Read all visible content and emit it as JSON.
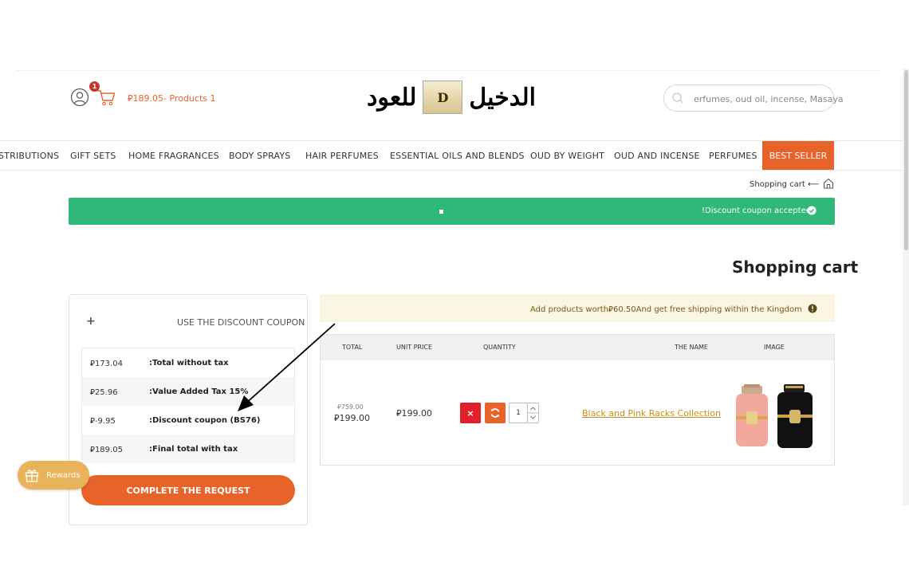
{
  "header": {
    "cart_badge": "1",
    "cart_summary": "⃁189.05- Products 1",
    "logo_text_left": "للعود",
    "logo_text_right": "الدخيل",
    "logo_badge": "D",
    "search_placeholder": "erfumes, oud oil, incense, Masaya"
  },
  "nav": {
    "items": [
      "STRIBUTIONS",
      "GIFT SETS",
      "HOME FRAGRANCES",
      "BODY SPRAYS",
      "HAIR PERFUMES",
      "ESSENTIAL OILS AND BLENDS",
      "OUD BY WEIGHT",
      "OUD AND INCENSE",
      "PERFUMES"
    ],
    "best_seller": "BEST SELLER"
  },
  "breadcrumb": {
    "text": "Shopping cart ⟵"
  },
  "alert": {
    "text": "!Discount coupon accepted"
  },
  "page_title": "Shopping cart",
  "summary": {
    "coupon_toggle": "+",
    "coupon_label": "USE THE DISCOUNT COUPON",
    "rows": [
      {
        "amount": "⃁173.04",
        "label": ":Total without tax"
      },
      {
        "amount": "⃁25.96",
        "label": ":Value Added Tax 15%"
      },
      {
        "amount": "⃁-9.95",
        "label": ":Discount coupon (BS76)"
      },
      {
        "amount": "⃁189.05",
        "label": ":Final total with tax"
      }
    ],
    "complete_button": "COMPLETE THE REQUEST"
  },
  "rewards": {
    "label": "Rewards"
  },
  "shipping_notice": "Add products worth⃁60.50And get free shipping within the Kingdom",
  "cart_table": {
    "headers": {
      "total": "TOTAL",
      "unit_price": "UNIT PRICE",
      "quantity": "QUANTITY",
      "name": "THE NAME",
      "image": "IMAGE"
    },
    "rows": [
      {
        "old_total": "⃁759.00",
        "total": "⃁199.00",
        "unit_price": "⃁199.00",
        "remove": "×",
        "quantity": "1",
        "name": "Black and Pink Racks Collection"
      }
    ]
  },
  "colors": {
    "accent": "#e8632a",
    "success": "#2fb879",
    "link": "#c8901a",
    "remove": "#e0202a"
  }
}
